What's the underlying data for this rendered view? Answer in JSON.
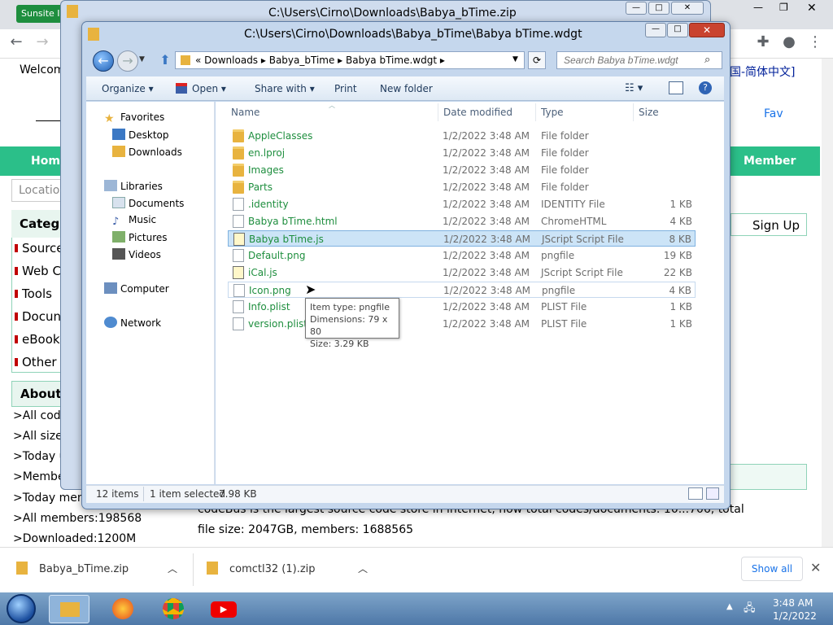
{
  "browser": {
    "tab_badge": "Sunsite I",
    "welcome": "Welcom",
    "lang": "国-简体中文]",
    "fav": "Fav",
    "nav_home": "Hom",
    "nav_member": "Member",
    "location": "Location",
    "categories_head": "Categ",
    "categories": [
      "Source",
      "Web C",
      "Tools",
      "Docun",
      "eBook",
      "Other"
    ],
    "signup": "Sign Up",
    "about_head": "About",
    "about_lines": [
      ">All code",
      ">All size",
      ">Today u",
      ">Membe",
      ">Today mem",
      ">All members:198568",
      ">Downloaded:1200M"
    ],
    "intro_line1": "codeBus is the largest source code store in internet, now total codes/documents: 10...706, total",
    "intro_line2": "file size: 2047GB, members: 1688565"
  },
  "downloads": {
    "items": [
      "Babya_bTime.zip",
      "comctl32 (1).zip"
    ],
    "show_all": "Show all"
  },
  "taskbar": {
    "time": "3:48 AM",
    "date": "1/2/2022"
  },
  "zip_window": {
    "title": "C:\\Users\\Cirno\\Downloads\\Babya_bTime.zip"
  },
  "explorer": {
    "title": "C:\\Users\\Cirno\\Downloads\\Babya_bTime\\Babya bTime.wdgt",
    "address": "«  Downloads  ▸  Babya_bTime  ▸  Babya bTime.wdgt  ▸",
    "search_placeholder": "Search Babya bTime.wdgt",
    "commands": {
      "organize": "Organize ▾",
      "open": "Open ▾",
      "share": "Share with ▾",
      "print": "Print",
      "new_folder": "New folder"
    },
    "nav": {
      "favorites": "Favorites",
      "desktop": "Desktop",
      "downloads": "Downloads",
      "libraries": "Libraries",
      "documents": "Documents",
      "music": "Music",
      "pictures": "Pictures",
      "videos": "Videos",
      "computer": "Computer",
      "network": "Network"
    },
    "columns": {
      "name": "Name",
      "date": "Date modified",
      "type": "Type",
      "size": "Size"
    },
    "files": [
      {
        "name": "AppleClasses",
        "date": "1/2/2022 3:48 AM",
        "type": "File folder",
        "size": "",
        "kind": "folder"
      },
      {
        "name": "en.lproj",
        "date": "1/2/2022 3:48 AM",
        "type": "File folder",
        "size": "",
        "kind": "folder"
      },
      {
        "name": "Images",
        "date": "1/2/2022 3:48 AM",
        "type": "File folder",
        "size": "",
        "kind": "folder"
      },
      {
        "name": "Parts",
        "date": "1/2/2022 3:48 AM",
        "type": "File folder",
        "size": "",
        "kind": "folder"
      },
      {
        "name": ".identity",
        "date": "1/2/2022 3:48 AM",
        "type": "IDENTITY File",
        "size": "1 KB",
        "kind": "doc"
      },
      {
        "name": "Babya bTime.html",
        "date": "1/2/2022 3:48 AM",
        "type": "ChromeHTML",
        "size": "4 KB",
        "kind": "doc"
      },
      {
        "name": "Babya bTime.js",
        "date": "1/2/2022 3:48 AM",
        "type": "JScript Script File",
        "size": "8 KB",
        "kind": "js"
      },
      {
        "name": "Default.png",
        "date": "1/2/2022 3:48 AM",
        "type": "pngfile",
        "size": "19 KB",
        "kind": "doc"
      },
      {
        "name": "iCal.js",
        "date": "1/2/2022 3:48 AM",
        "type": "JScript Script File",
        "size": "22 KB",
        "kind": "js"
      },
      {
        "name": "Icon.png",
        "date": "1/2/2022 3:48 AM",
        "type": "pngfile",
        "size": "4 KB",
        "kind": "doc"
      },
      {
        "name": "Info.plist",
        "date": "1/2/2022 3:48 AM",
        "type": "PLIST File",
        "size": "1 KB",
        "kind": "doc"
      },
      {
        "name": "version.plist",
        "date": "1/2/2022 3:48 AM",
        "type": "PLIST File",
        "size": "1 KB",
        "kind": "doc"
      }
    ],
    "tooltip": {
      "line1": "Item type: pngfile",
      "line2": "Dimensions: 79 x 80",
      "line3": "Size: 3.29 KB"
    },
    "status": {
      "count": "12 items",
      "selected": "1 item selected",
      "sel_size": "7.98 KB"
    }
  }
}
